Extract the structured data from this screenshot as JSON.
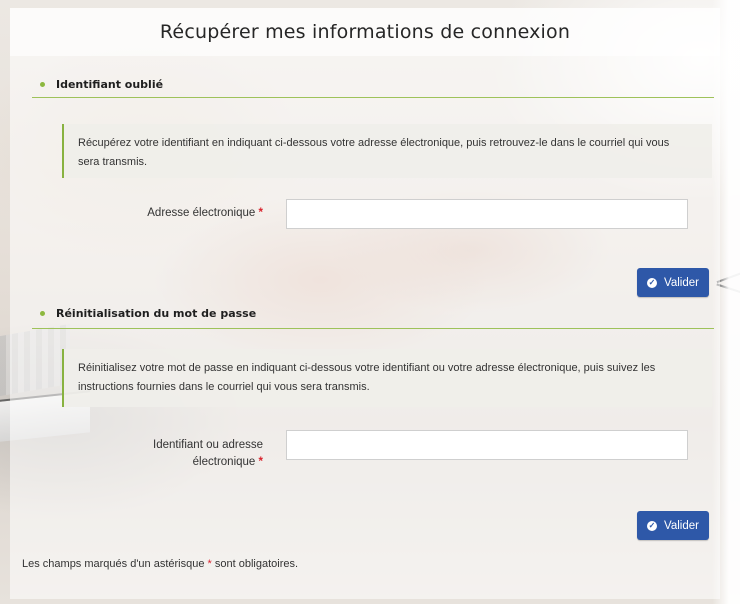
{
  "page": {
    "title": "Récupérer mes informations de connexion"
  },
  "identifier_section": {
    "heading": "Identifiant oublié",
    "info_text": "Récupérez votre identifiant en indiquant ci-dessous votre adresse électronique, puis retrouvez-le dans le courriel qui vous sera transmis.",
    "email_label": "Adresse électronique",
    "email_value": "",
    "submit_label": "Valider"
  },
  "password_section": {
    "heading": "Réinitialisation du mot de passe",
    "info_text": "Réinitialisez votre mot de passe en indiquant ci-dessous votre identifiant ou votre adresse électronique, puis suivez les instructions fournies dans le courriel qui vous sera transmis.",
    "id_label_line1": "Identifiant ou adresse",
    "id_label_line2": "électronique",
    "id_value": "",
    "submit_label": "Valider"
  },
  "required_marker": "*",
  "footnote": {
    "before": "Les champs marqués d'un astérisque",
    "marker": "*",
    "after": "sont obligatoires."
  },
  "colors": {
    "accent_green": "#8db83f",
    "button_blue": "#2e58a8",
    "required_red": "#d9232d"
  },
  "icons": {
    "submit_icon": "check-circle-icon",
    "section_bullet": "bullet-icon"
  }
}
